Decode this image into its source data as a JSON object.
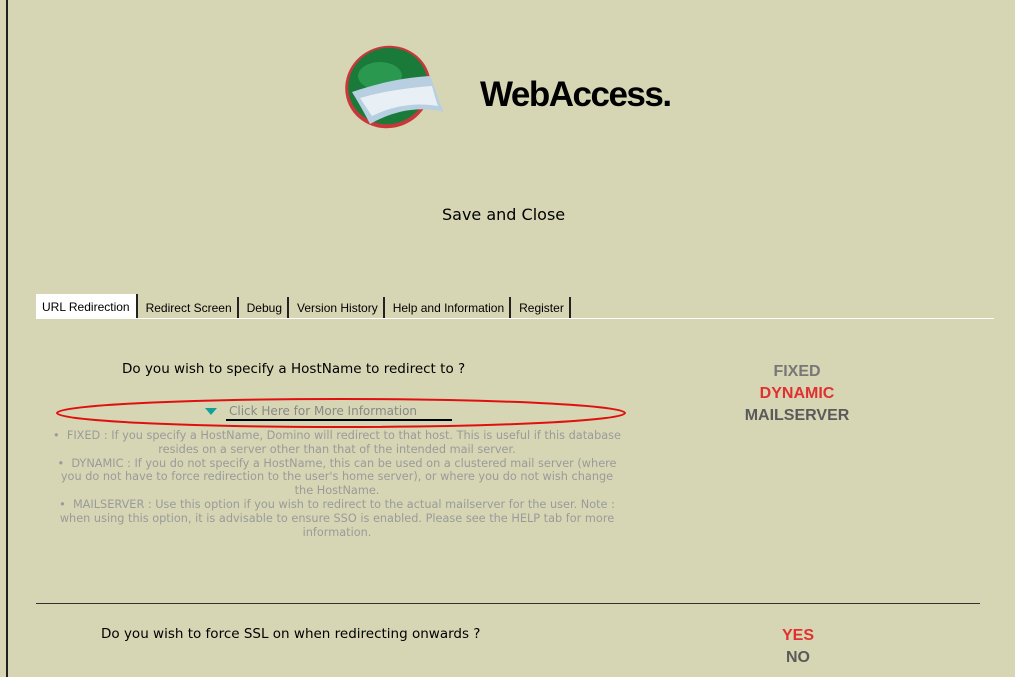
{
  "header": {
    "brand_text": "WebAccess.",
    "save_close_label": "Save and Close"
  },
  "tabs": [
    {
      "label": "URL Redirection",
      "active": true
    },
    {
      "label": "Redirect Screen"
    },
    {
      "label": "Debug"
    },
    {
      "label": "Version History"
    },
    {
      "label": "Help and Information"
    },
    {
      "label": "Register"
    }
  ],
  "redirection": {
    "question": "Do you wish to specify a HostName to redirect to ?",
    "more_info_link": "Click Here for More Information",
    "info_items": [
      "FIXED : If you specify a HostName, Domino will redirect to that host. This is useful if this database resides on a server other than that of the intended mail server.",
      "DYNAMIC : If you do not specify a HostName, this can be used on a clustered mail server (where you do not have to force redirection to the user's home server), or where you do not wish change the HostName.",
      "MAILSERVER : Use this option if you wish to redirect to the actual mailserver for the user. Note : when using this option, it is advisable to ensure SSO is enabled. Please see the HELP tab for more information."
    ],
    "options": [
      "FIXED",
      "DYNAMIC",
      "MAILSERVER"
    ],
    "selected": "DYNAMIC"
  },
  "ssl": {
    "question": "Do you wish to force SSL on when redirecting onwards ?",
    "options": [
      "YES",
      "NO"
    ],
    "selected": "YES"
  },
  "colors": {
    "background": "#d6d6b4",
    "selected_option": "#e03030",
    "link_triangle": "#12a19a",
    "annotation_ellipse": "#e01010"
  }
}
